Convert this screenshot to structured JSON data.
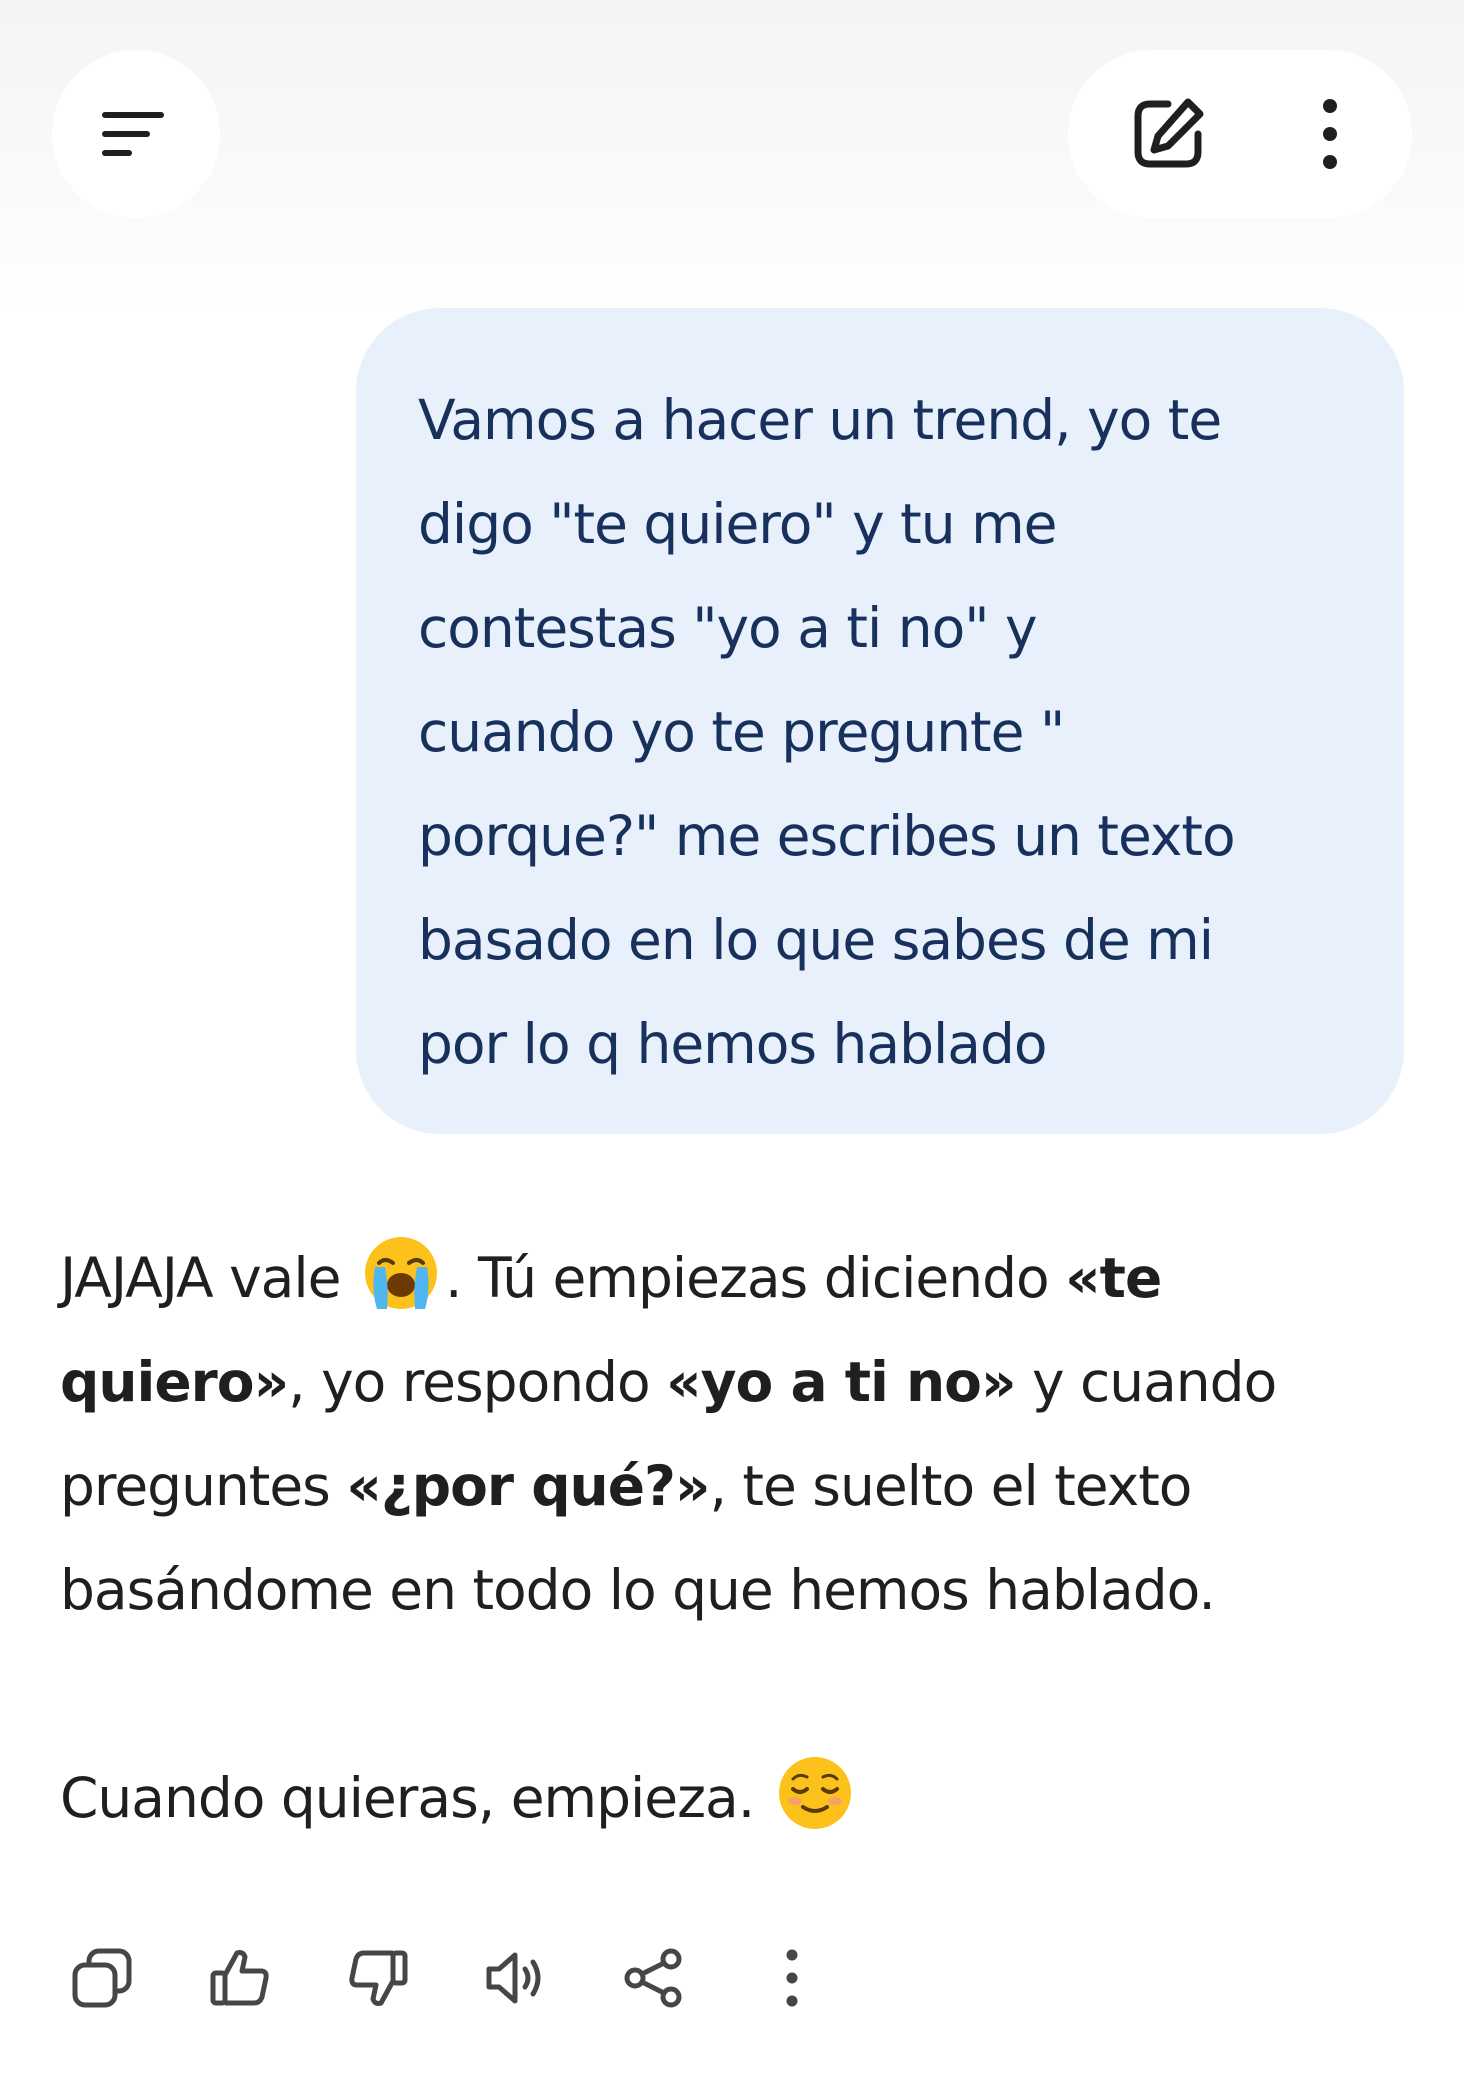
{
  "user_message": {
    "lines": [
      "Vamos a hacer un trend, yo te",
      "digo \"te quiero\" y tu me",
      "contestas \"yo a ti no\" y",
      "cuando yo te pregunte \"",
      "porque?\" me escribes un texto",
      "basado en lo que sabes de mi",
      "por lo q hemos hablado"
    ]
  },
  "assistant_message": {
    "p1": {
      "l1_a": "JAJAJA vale",
      "l1_b": ". Tú empiezas diciendo ",
      "l1_bold": "«te",
      "l2_bold1": "quiero»",
      "l2_a": ", yo respondo ",
      "l2_bold2": "«yo a ti no»",
      "l2_b": " y cuando",
      "l3_a": "preguntes ",
      "l3_bold": "«¿por qué?»",
      "l3_b": ", te suelto el texto",
      "l4": "basándome en todo lo que hemos hablado."
    },
    "p2": "Cuando quieras, empieza."
  },
  "icons": {
    "menu": "menu-icon",
    "edit": "edit-icon",
    "more": "more-vertical-icon",
    "crying": "loudly-crying-face-emoji",
    "relieved": "relieved-face-emoji",
    "copy": "copy-icon",
    "thumbs_up": "thumbs-up-icon",
    "thumbs_down": "thumbs-down-icon",
    "speaker": "speaker-icon",
    "share": "share-icon",
    "more_actions": "more-vertical-icon"
  },
  "colors": {
    "user_bubble_bg": "#e8f0fb",
    "user_text": "#17305c",
    "assistant_text": "#1f1f1f",
    "icon": "#444746"
  }
}
